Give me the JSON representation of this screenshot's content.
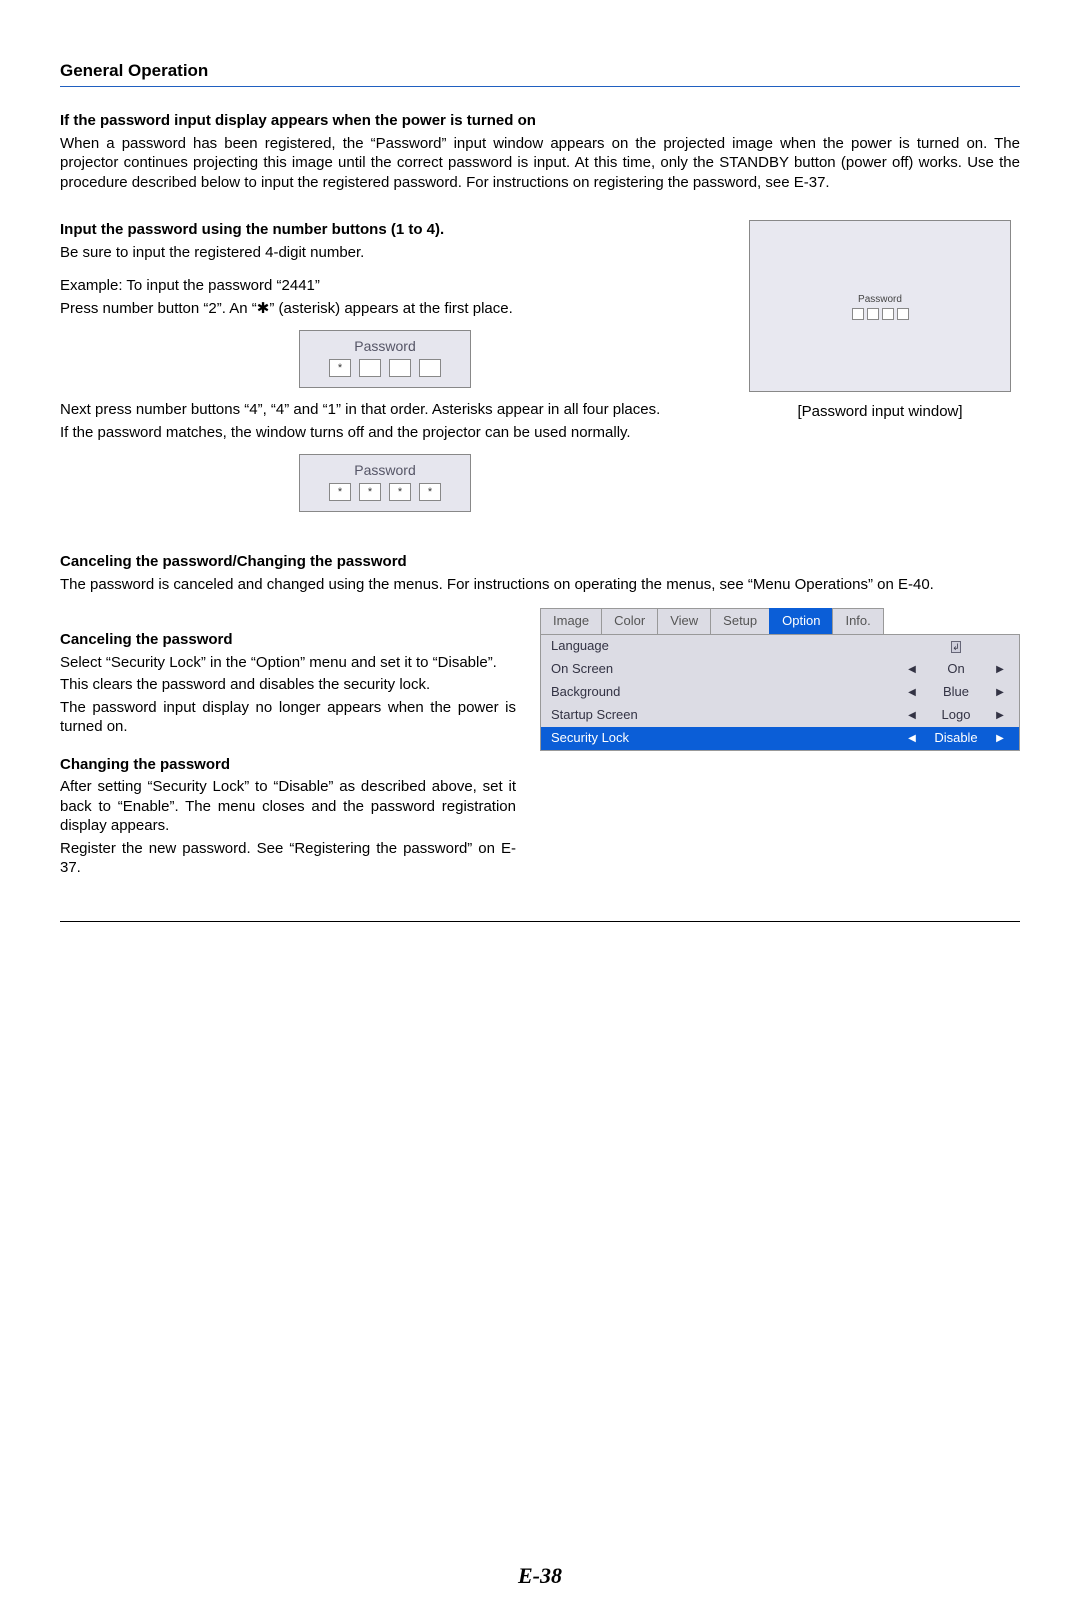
{
  "title": "General Operation",
  "section1": {
    "heading": "If the password input display appears when the power is turned on",
    "para": "When a password has been registered, the “Password” input window appears on the projected image when the power is turned on. The projector continues projecting this image until the correct password is input. At this time, only the STANDBY button (power off) works. Use the procedure described below to input the registered password. For instructions on registering the password, see E-37."
  },
  "section2": {
    "heading": "Input the password using the number buttons (1 to 4).",
    "line1": "Be sure to input the registered 4-digit number.",
    "line2": "Example: To input the password “2441”",
    "line3": "Press number button “2”. An “✱” (asterisk) appears at the first place."
  },
  "password_label": "Password",
  "asterisk": "*",
  "password_caption": "[Password input window]",
  "section3": {
    "para1": "Next press number buttons “4”, “4” and “1” in that order. Asterisks appear in all four places.",
    "para2": "If the password matches, the window turns off and the projector can be used normally."
  },
  "section4": {
    "heading": "Canceling the password/Changing the password",
    "para": "The password is canceled and changed using the menus. For instructions on operating the menus, see “Menu Operations” on E-40."
  },
  "cancel": {
    "heading": "Canceling the password",
    "line1": "Select “Security Lock” in the “Option” menu and set it to “Disable”.",
    "line2": "This clears the password and disables the security lock.",
    "line3": "The password input display no longer appears when the power is turned on."
  },
  "change": {
    "heading": "Changing the password",
    "line1": "After setting “Security Lock” to “Disable” as described above, set it back to “Enable”. The menu closes and the password registration display appears.",
    "line2": "Register the new password. See “Registering the password” on E-37."
  },
  "menu": {
    "tabs": [
      "Image",
      "Color",
      "View",
      "Setup",
      "Option",
      "Info."
    ],
    "active_tab": "Option",
    "rows": [
      {
        "label": "Language",
        "left": "",
        "value_icon": true,
        "right": ""
      },
      {
        "label": "On Screen",
        "left": "◀",
        "value": "On",
        "right": "▶"
      },
      {
        "label": "Background",
        "left": "◀",
        "value": "Blue",
        "right": "▶"
      },
      {
        "label": "Startup Screen",
        "left": "◀",
        "value": "Logo",
        "right": "▶"
      },
      {
        "label": "Security Lock",
        "left": "◀",
        "value": "Disable",
        "right": "▶",
        "selected": true
      }
    ]
  },
  "enter_symbol": "↲",
  "left_tri": "◀",
  "right_tri": "▶",
  "page_number": "E-38"
}
